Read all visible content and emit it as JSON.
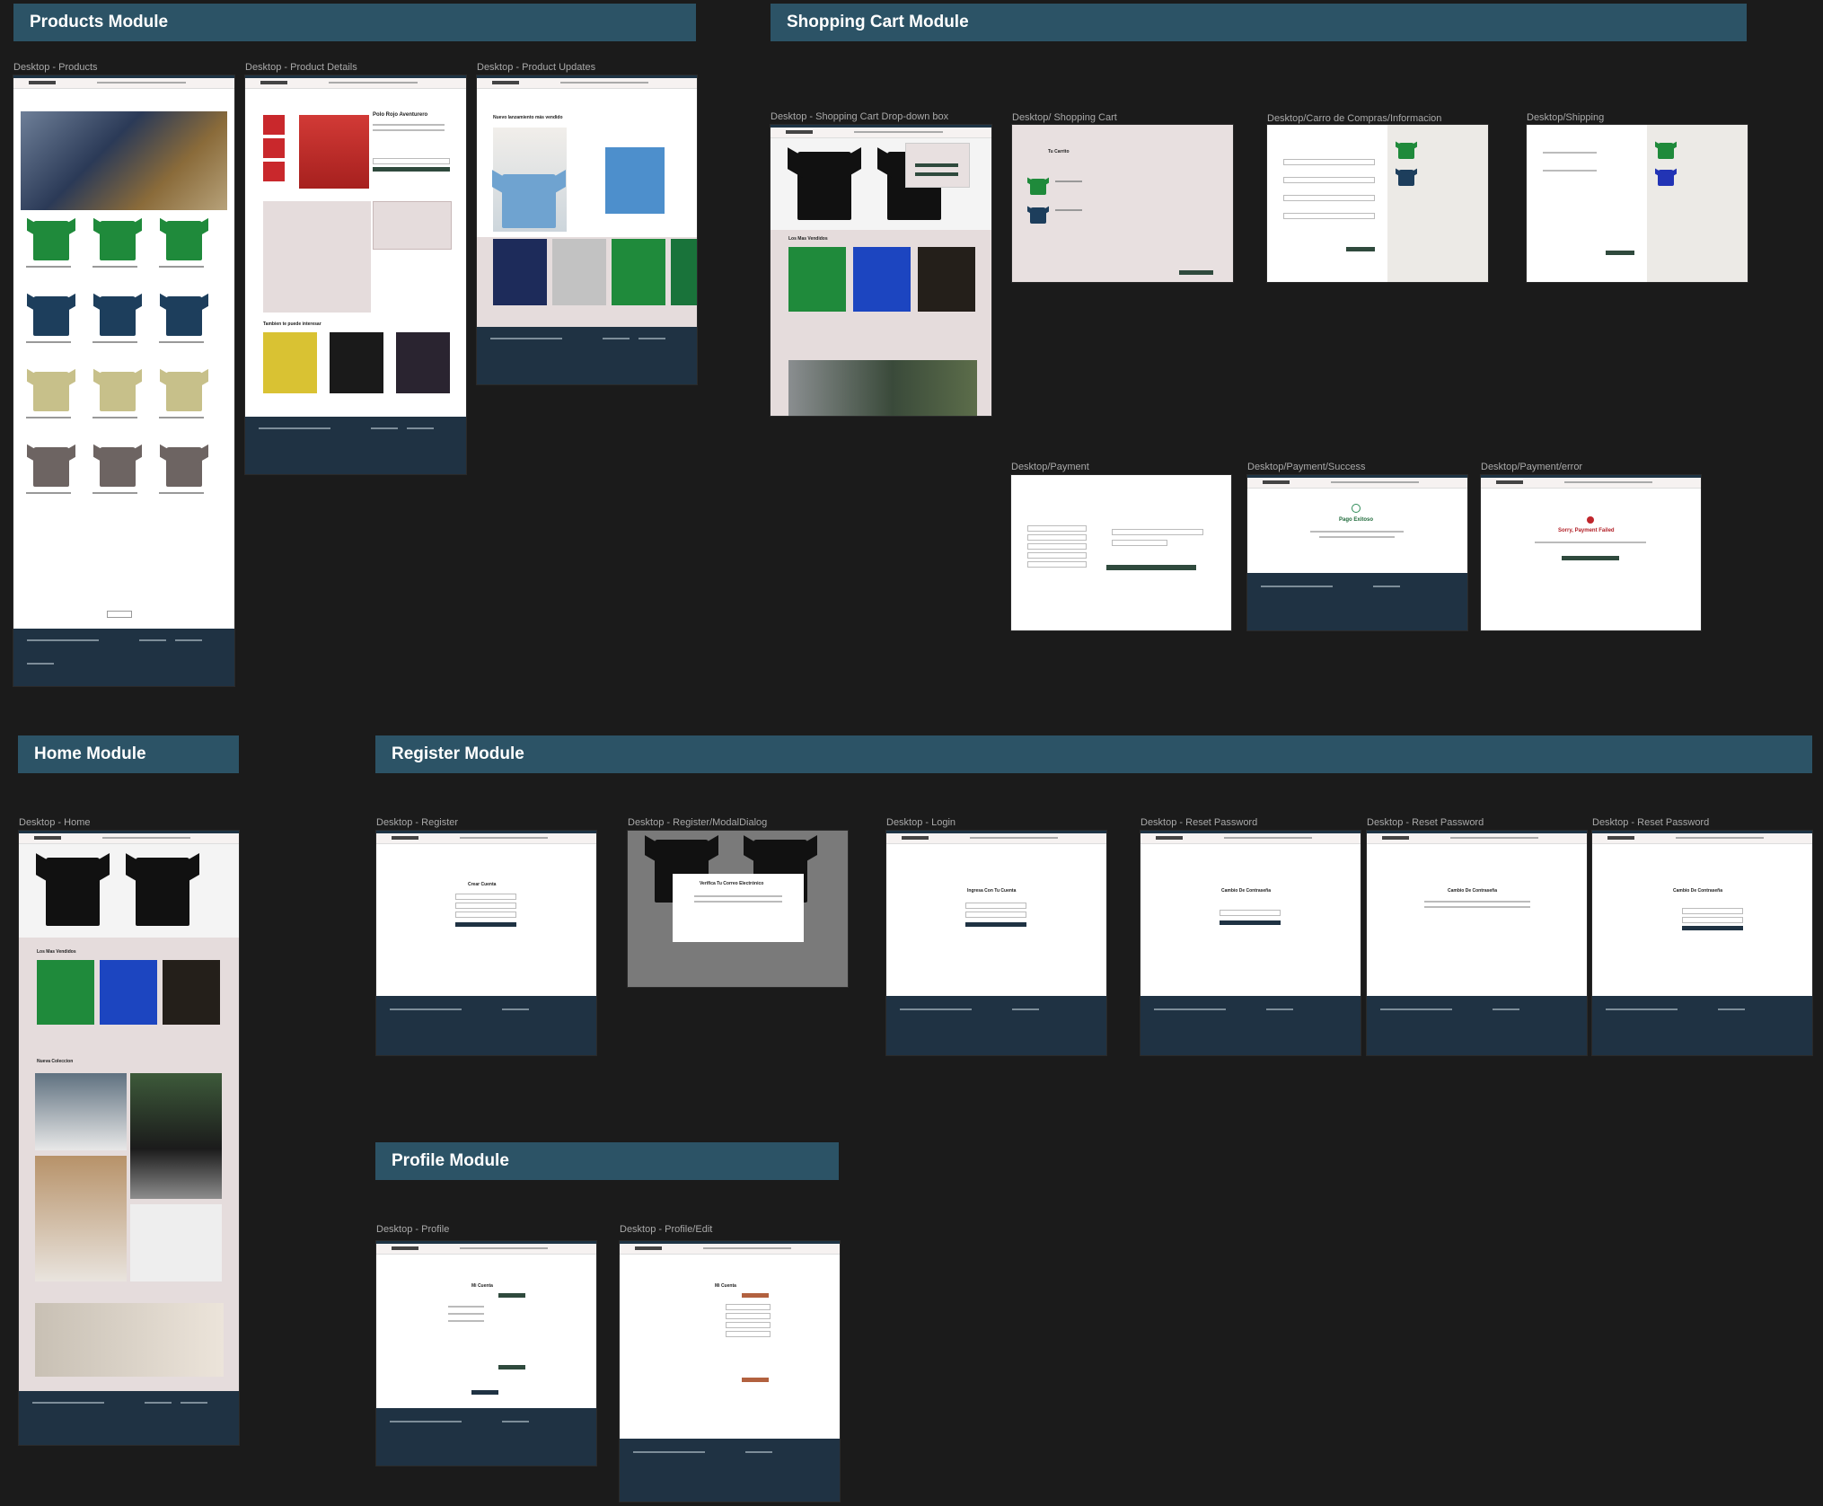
{
  "sections": {
    "products": "Products Module",
    "cart": "Shopping Cart Module",
    "home": "Home Module",
    "register": "Register Module",
    "profile": "Profile Module"
  },
  "frames": {
    "products": "Desktop - Products",
    "product_details": "Desktop - Product Details",
    "product_updates": "Desktop - Product Updates",
    "cart_dropdown": "Desktop - Shopping Cart Drop-down box",
    "shopping_cart": "Desktop/ Shopping Cart",
    "cart_info": "Desktop/Carro de Compras/Informacion",
    "shipping": "Desktop/Shipping",
    "payment": "Desktop/Payment",
    "payment_success": "Desktop/Payment/Success",
    "payment_error": "Desktop/Payment/error",
    "home": "Desktop - Home",
    "register": "Desktop - Register",
    "register_modal": "Desktop - Register/ModalDialog",
    "login": "Desktop - Login",
    "reset1": "Desktop - Reset Password",
    "reset2": "Desktop - Reset Password",
    "reset3": "Desktop - Reset Password",
    "profile": "Desktop - Profile",
    "profile_edit": "Desktop - Profile/Edit"
  },
  "screen_text": {
    "product_title": "Polo Rojo Aventurero",
    "also_like": "Tambien te puede interesar",
    "new_release": "Nuevo lanzamiento más vendido",
    "best_sellers": "Los Mas Vendidos",
    "new_collection": "Nueva Coleccion",
    "tu_carrito": "Tu Carrito",
    "pago_exitoso": "Pago Exitoso",
    "payment_failed": "Sorry, Payment Failed",
    "crear_cuenta": "Crear Cuenta",
    "verifica_correo": "Verifica Tu Correo Electrónico",
    "ingresa": "Ingresa Con Tu Cuenta",
    "cambio_contrasena": "Cambio De Contraseña",
    "mi_cuenta": "Mi Cuenta"
  },
  "colors": {
    "header": "#2c5366",
    "canvas": "#1b1b1b",
    "footer": "#1f3243",
    "accent_green": "#2f4a3d",
    "accent_brown": "#b2613f"
  }
}
